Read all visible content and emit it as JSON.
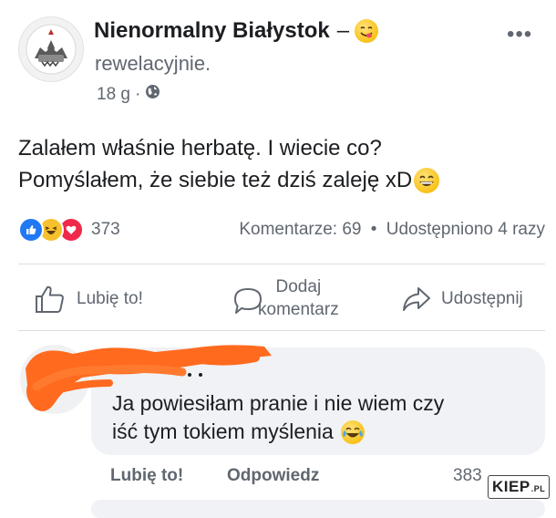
{
  "post": {
    "author": "Nienormalny Białystok",
    "author_separator": "–",
    "author_emoji": "face-savoring-emoji",
    "subtitle": "rewelacyjnie.",
    "time": "18 g",
    "meta_separator": "·",
    "privacy_icon": "globe-icon",
    "more_label": "•••",
    "text_line1": "Zalałem właśnie herbatę. I wiecie co?",
    "text_line2": "Pomyślałem, że siebie też dziś zaleję xD",
    "text_emoji": "grinning-emoji"
  },
  "reactions": {
    "types": [
      "like-icon",
      "haha-icon",
      "love-icon"
    ],
    "count": "373",
    "comments_label": "Komentarze: 69",
    "separator": "•",
    "shares_label": "Udostępniono 4 razy"
  },
  "actions": {
    "like": "Lubię to!",
    "comment_line1": "Dodaj",
    "comment_line2": "komentarz",
    "share": "Udostępnij"
  },
  "comment": {
    "text_line1": "Ja powiesiłam pranie i nie wiem czy",
    "text_line2": "iść tym tokiem myślenia",
    "emoji": "tears-of-joy-emoji",
    "like_label": "Lubię to!",
    "reply_label": "Odpowiedz",
    "reaction_count": "383"
  },
  "watermark": {
    "text": "KIEP",
    "suffix": ".PL"
  },
  "colors": {
    "text": "#1c1e21",
    "secondary": "#606770",
    "like_blue": "#2078f4",
    "love_red": "#f0284a",
    "haha_yellow": "#f7c12d",
    "bubble": "#f0f2f5",
    "scribble": "#ff6a1f"
  }
}
